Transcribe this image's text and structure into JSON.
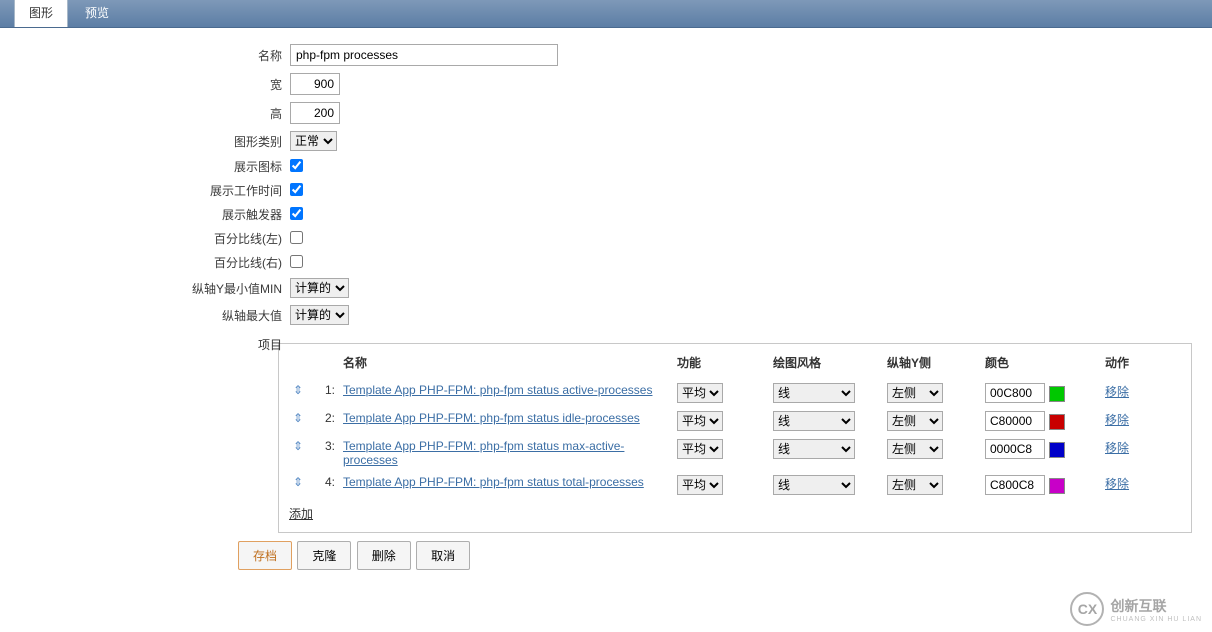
{
  "tabs": {
    "graph": "图形",
    "preview": "预览"
  },
  "form": {
    "name_label": "名称",
    "name_value": "php-fpm processes",
    "width_label": "宽",
    "width_value": "900",
    "height_label": "高",
    "height_value": "200",
    "type_label": "图形类别",
    "type_value": "正常",
    "show_legend_label": "展示图标",
    "show_worktime_label": "展示工作时间",
    "show_triggers_label": "展示触发器",
    "percent_left_label": "百分比线(左)",
    "percent_right_label": "百分比线(右)",
    "ymin_label": "纵轴Y最小值MIN",
    "ymin_value": "计算的",
    "ymax_label": "纵轴最大值",
    "ymax_value": "计算的",
    "items_label": "项目"
  },
  "items": {
    "headers": {
      "name": "名称",
      "func": "功能",
      "draw": "绘图风格",
      "yaxis": "纵轴Y侧",
      "color": "颜色",
      "action": "动作"
    },
    "func_default": "平均",
    "draw_default": "线",
    "yaxis_default": "左侧",
    "remove_label": "移除",
    "add_label": "添加",
    "rows": [
      {
        "idx": "1:",
        "name": "Template App PHP-FPM: php-fpm status active-processes",
        "color": "00C800",
        "swatch": "#00C800"
      },
      {
        "idx": "2:",
        "name": "Template App PHP-FPM: php-fpm status idle-processes",
        "color": "C80000",
        "swatch": "#C80000"
      },
      {
        "idx": "3:",
        "name": "Template App PHP-FPM: php-fpm status max-active-processes",
        "color": "0000C8",
        "swatch": "#0000C8"
      },
      {
        "idx": "4:",
        "name": "Template App PHP-FPM: php-fpm status total-processes",
        "color": "C800C8",
        "swatch": "#C800C8"
      }
    ]
  },
  "buttons": {
    "save": "存档",
    "clone": "克隆",
    "delete": "删除",
    "cancel": "取消"
  },
  "watermark": {
    "logo": "CX",
    "text": "创新互联",
    "sub": "CHUANG XIN HU LIAN"
  }
}
